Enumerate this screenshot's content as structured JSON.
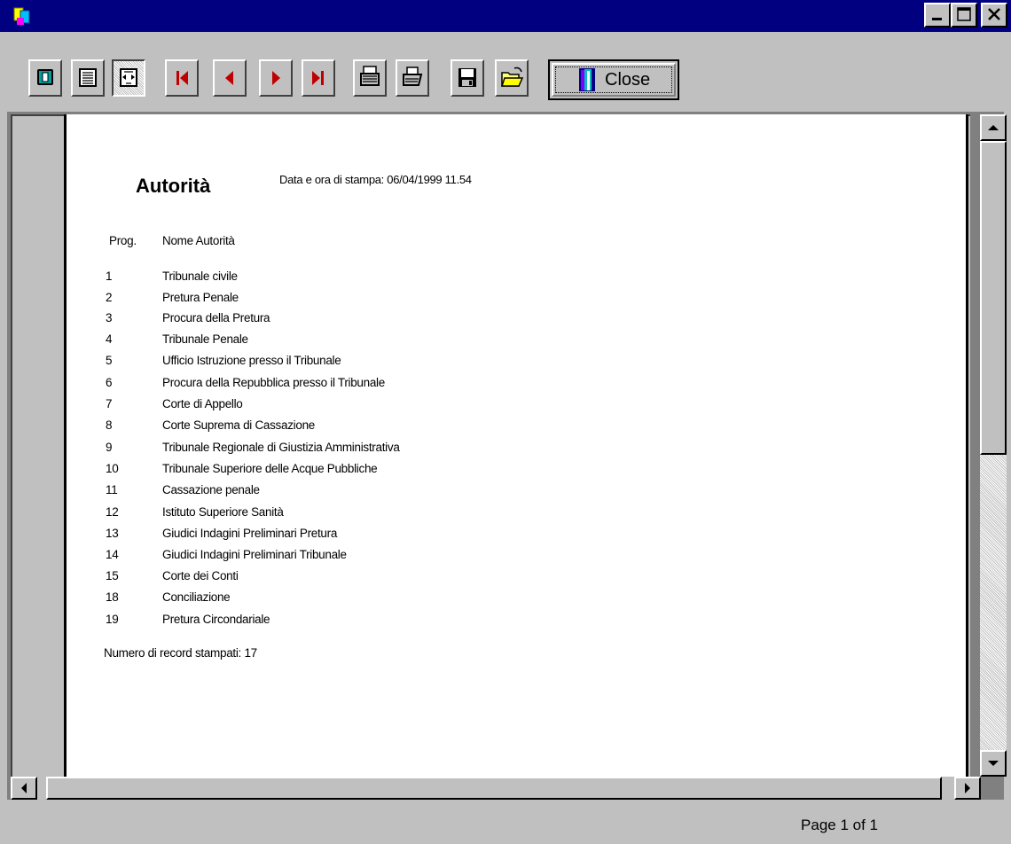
{
  "window": {
    "title": "",
    "controls": [
      "minimize",
      "maximize",
      "close"
    ]
  },
  "toolbar": {
    "buttons": [
      {
        "name": "single-page-view",
        "icon": "single-page-icon"
      },
      {
        "name": "multi-line-view",
        "icon": "lines-icon"
      },
      {
        "name": "fit-width-view",
        "icon": "fit-width-icon",
        "pressed": true
      },
      {
        "name": "first-page",
        "icon": "first-page-icon"
      },
      {
        "name": "previous-page",
        "icon": "previous-page-icon"
      },
      {
        "name": "next-page",
        "icon": "next-page-icon"
      },
      {
        "name": "last-page",
        "icon": "last-page-icon"
      },
      {
        "name": "print-setup",
        "icon": "printer-setup-icon"
      },
      {
        "name": "print",
        "icon": "printer-icon"
      },
      {
        "name": "save",
        "icon": "floppy-disk-icon"
      },
      {
        "name": "open",
        "icon": "open-folder-icon"
      }
    ],
    "close_label": "Close",
    "close_icon": "exit-door-icon"
  },
  "report": {
    "title": "Autorità",
    "print_date": "Data e ora di stampa: 06/04/1999 11.54",
    "headers": {
      "prog": "Prog.",
      "name": "Nome Autorità"
    },
    "rows": [
      {
        "prog": "1",
        "name": "Tribunale civile"
      },
      {
        "prog": "2",
        "name": "Pretura Penale"
      },
      {
        "prog": "3",
        "name": "Procura della Pretura"
      },
      {
        "prog": "4",
        "name": "Tribunale Penale"
      },
      {
        "prog": "5",
        "name": "Ufficio Istruzione presso il Tribunale"
      },
      {
        "prog": "6",
        "name": "Procura della Repubblica presso il Tribunale"
      },
      {
        "prog": "7",
        "name": "Corte di Appello"
      },
      {
        "prog": "8",
        "name": "Corte Suprema di Cassazione"
      },
      {
        "prog": "9",
        "name": "Tribunale Regionale di Giustizia Amministrativa"
      },
      {
        "prog": "10",
        "name": "Tribunale Superiore delle Acque Pubbliche"
      },
      {
        "prog": "11",
        "name": "Cassazione penale"
      },
      {
        "prog": "12",
        "name": "Istituto Superiore Sanità"
      },
      {
        "prog": "13",
        "name": "Giudici Indagini Preliminari Pretura"
      },
      {
        "prog": "14",
        "name": "Giudici Indagini Preliminari Tribunale"
      },
      {
        "prog": "15",
        "name": "Corte dei Conti"
      },
      {
        "prog": "18",
        "name": "Conciliazione"
      },
      {
        "prog": "19",
        "name": "Pretura Circondariale"
      }
    ],
    "summary": "Numero di record stampati: 17"
  },
  "status": {
    "page_text": "Page 1 of 1"
  }
}
